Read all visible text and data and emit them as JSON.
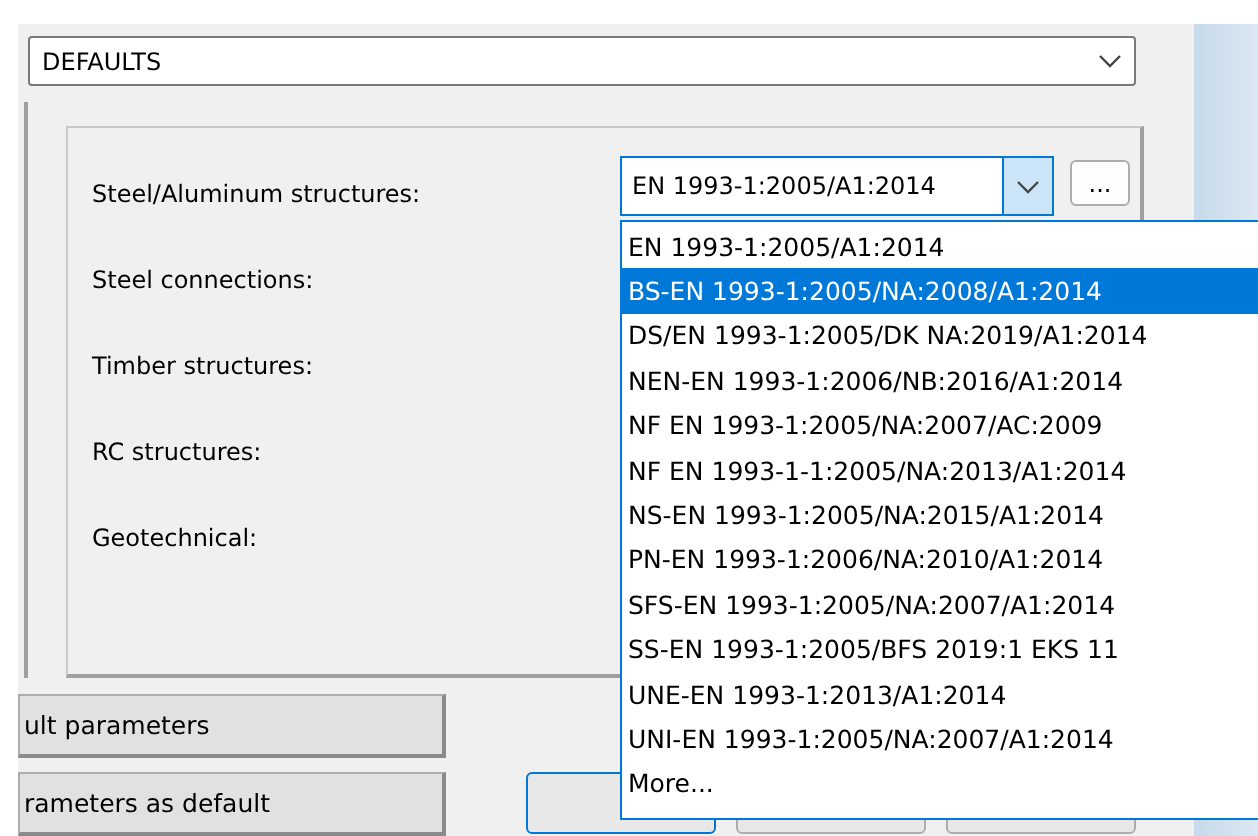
{
  "preset": {
    "value": "DEFAULTS"
  },
  "fields": [
    {
      "label": "Steel/Aluminum structures:",
      "value": "EN 1993-1:2005/A1:2014"
    },
    {
      "label": "Steel connections:"
    },
    {
      "label": "Timber structures:"
    },
    {
      "label": "RC structures:"
    },
    {
      "label": "Geotechnical:"
    }
  ],
  "browse_button": "...",
  "dropdown": {
    "items": [
      {
        "label": "EN 1993-1:2005/A1:2014",
        "selected": false
      },
      {
        "label": "BS-EN 1993-1:2005/NA:2008/A1:2014",
        "selected": true
      },
      {
        "label": "DS/EN 1993-1:2005/DK NA:2019/A1:2014",
        "selected": false
      },
      {
        "label": "NEN-EN 1993-1:2006/NB:2016/A1:2014",
        "selected": false
      },
      {
        "label": "NF EN 1993-1:2005/NA:2007/AC:2009",
        "selected": false
      },
      {
        "label": "NF EN 1993-1-1:2005/NA:2013/A1:2014",
        "selected": false
      },
      {
        "label": "NS-EN 1993-1:2005/NA:2015/A1:2014",
        "selected": false
      },
      {
        "label": "PN-EN 1993-1:2006/NA:2010/A1:2014",
        "selected": false
      },
      {
        "label": "SFS-EN 1993-1:2005/NA:2007/A1:2014",
        "selected": false
      },
      {
        "label": "SS-EN 1993-1:2005/BFS 2019:1 EKS 11",
        "selected": false
      },
      {
        "label": "UNE-EN 1993-1:2013/A1:2014",
        "selected": false
      },
      {
        "label": "UNI-EN 1993-1:2005/NA:2007/A1:2014",
        "selected": false
      },
      {
        "label": "More...",
        "selected": false
      }
    ]
  },
  "side_buttons": [
    "ult parameters",
    "rameters as default"
  ],
  "dialog_buttons": [
    {
      "focused": true
    },
    {
      "focused": false
    },
    {
      "focused": false
    }
  ]
}
